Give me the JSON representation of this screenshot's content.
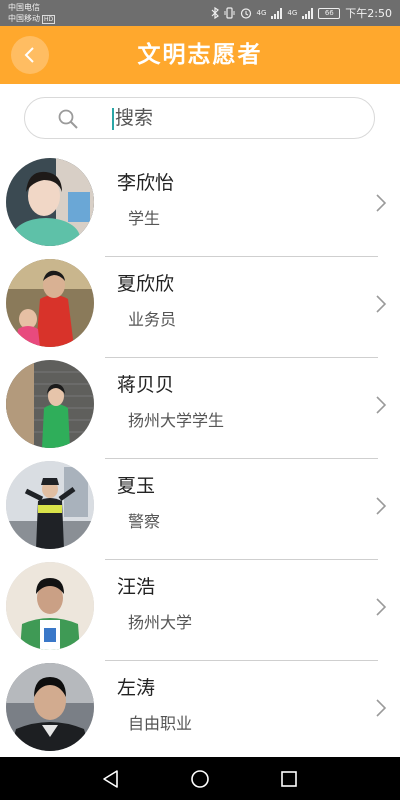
{
  "status_bar": {
    "carrier_1": "中国电信",
    "carrier_2": "中国移动",
    "carrier_2_badge": "HD",
    "net_1": "4G",
    "net_2": "4G",
    "battery": "66",
    "time": "下午2:50"
  },
  "header": {
    "title": "文明志愿者",
    "back_icon": "chevron-left-icon",
    "background": "#ffa82d"
  },
  "search": {
    "placeholder": "搜索",
    "value": "",
    "icon": "search-icon"
  },
  "volunteers": [
    {
      "name": "李欣怡",
      "role": "学生"
    },
    {
      "name": "夏欣欣",
      "role": "业务员"
    },
    {
      "name": "蒋贝贝",
      "role": "扬州大学学生"
    },
    {
      "name": "夏玉",
      "role": "警察"
    },
    {
      "name": "汪浩",
      "role": "扬州大学"
    },
    {
      "name": "左涛",
      "role": "自由职业"
    }
  ],
  "nav_bar": {
    "icons": [
      "back-triangle-icon",
      "home-circle-icon",
      "recents-square-icon"
    ]
  }
}
